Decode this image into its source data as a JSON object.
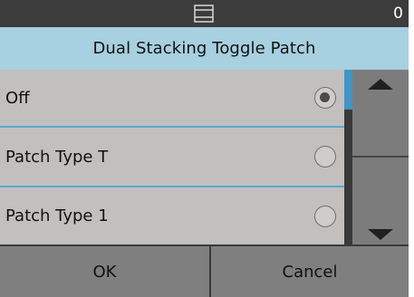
{
  "status_bar": {
    "icon": "document-tray-icon",
    "count": "0"
  },
  "title": "Dual Stacking Toggle Patch",
  "options": [
    {
      "label": "Off",
      "selected": true
    },
    {
      "label": "Patch Type T",
      "selected": false
    },
    {
      "label": "Patch Type 1",
      "selected": false
    }
  ],
  "scroll": {
    "up_icon": "arrow-up-icon",
    "down_icon": "arrow-down-icon"
  },
  "buttons": {
    "ok": "OK",
    "cancel": "Cancel"
  },
  "colors": {
    "status_bar": "#3c3c3c",
    "title_bar": "#a7d0e0",
    "list_bg": "#c2bfbf",
    "divider": "#5aa9cc",
    "scroll_thumb": "#3f95c5",
    "button_bg": "#7f7f7f"
  }
}
